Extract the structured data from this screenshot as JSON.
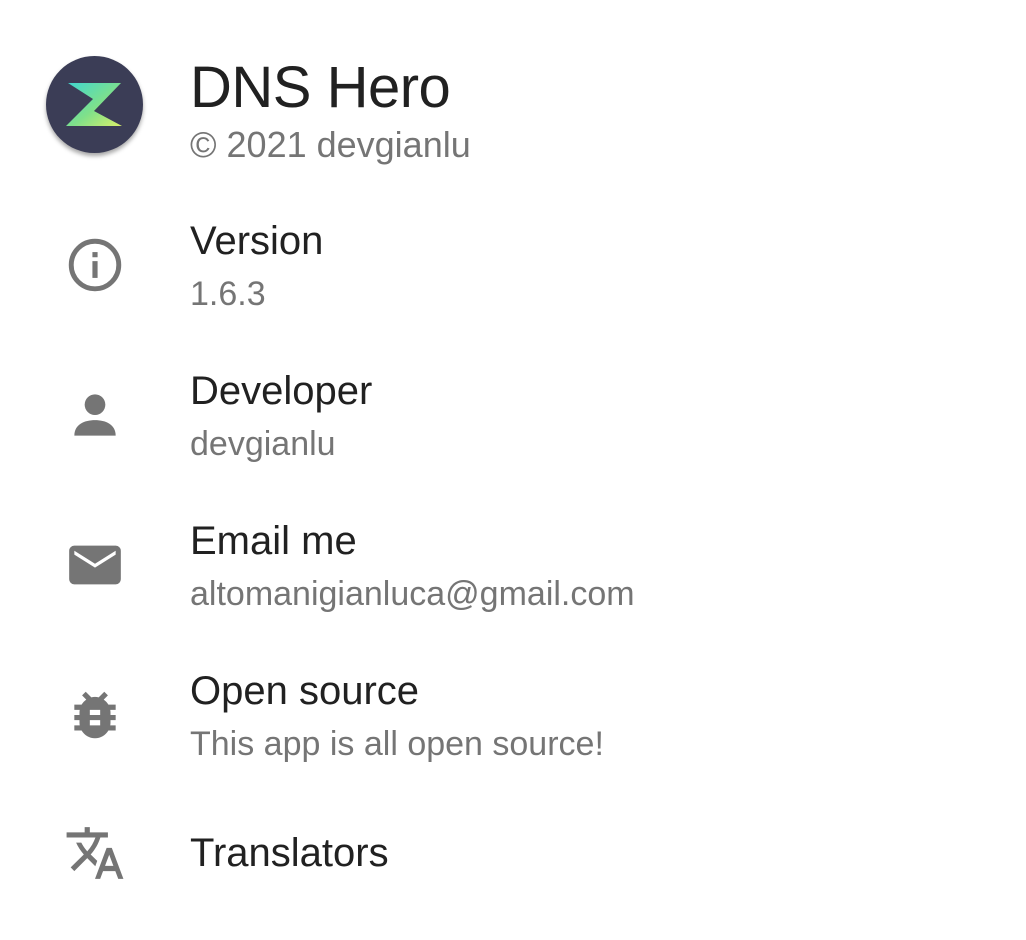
{
  "app": {
    "name": "DNS Hero",
    "copyright": "© 2021 devgianlu",
    "logo_icon": "dns-hero-z-logo-icon",
    "logo_bg_color": "#3b3d56"
  },
  "items": [
    {
      "icon": "info-icon",
      "title": "Version",
      "subtitle": "1.6.3"
    },
    {
      "icon": "person-icon",
      "title": "Developer",
      "subtitle": "devgianlu"
    },
    {
      "icon": "email-icon",
      "title": "Email me",
      "subtitle": "altomanigianluca@gmail.com"
    },
    {
      "icon": "bug-icon",
      "title": "Open source",
      "subtitle": "This app is all open source!"
    },
    {
      "icon": "translate-icon",
      "title": "Translators"
    }
  ],
  "colors": {
    "title": "#212121",
    "subtitle": "#757575",
    "icon": "#757575"
  }
}
